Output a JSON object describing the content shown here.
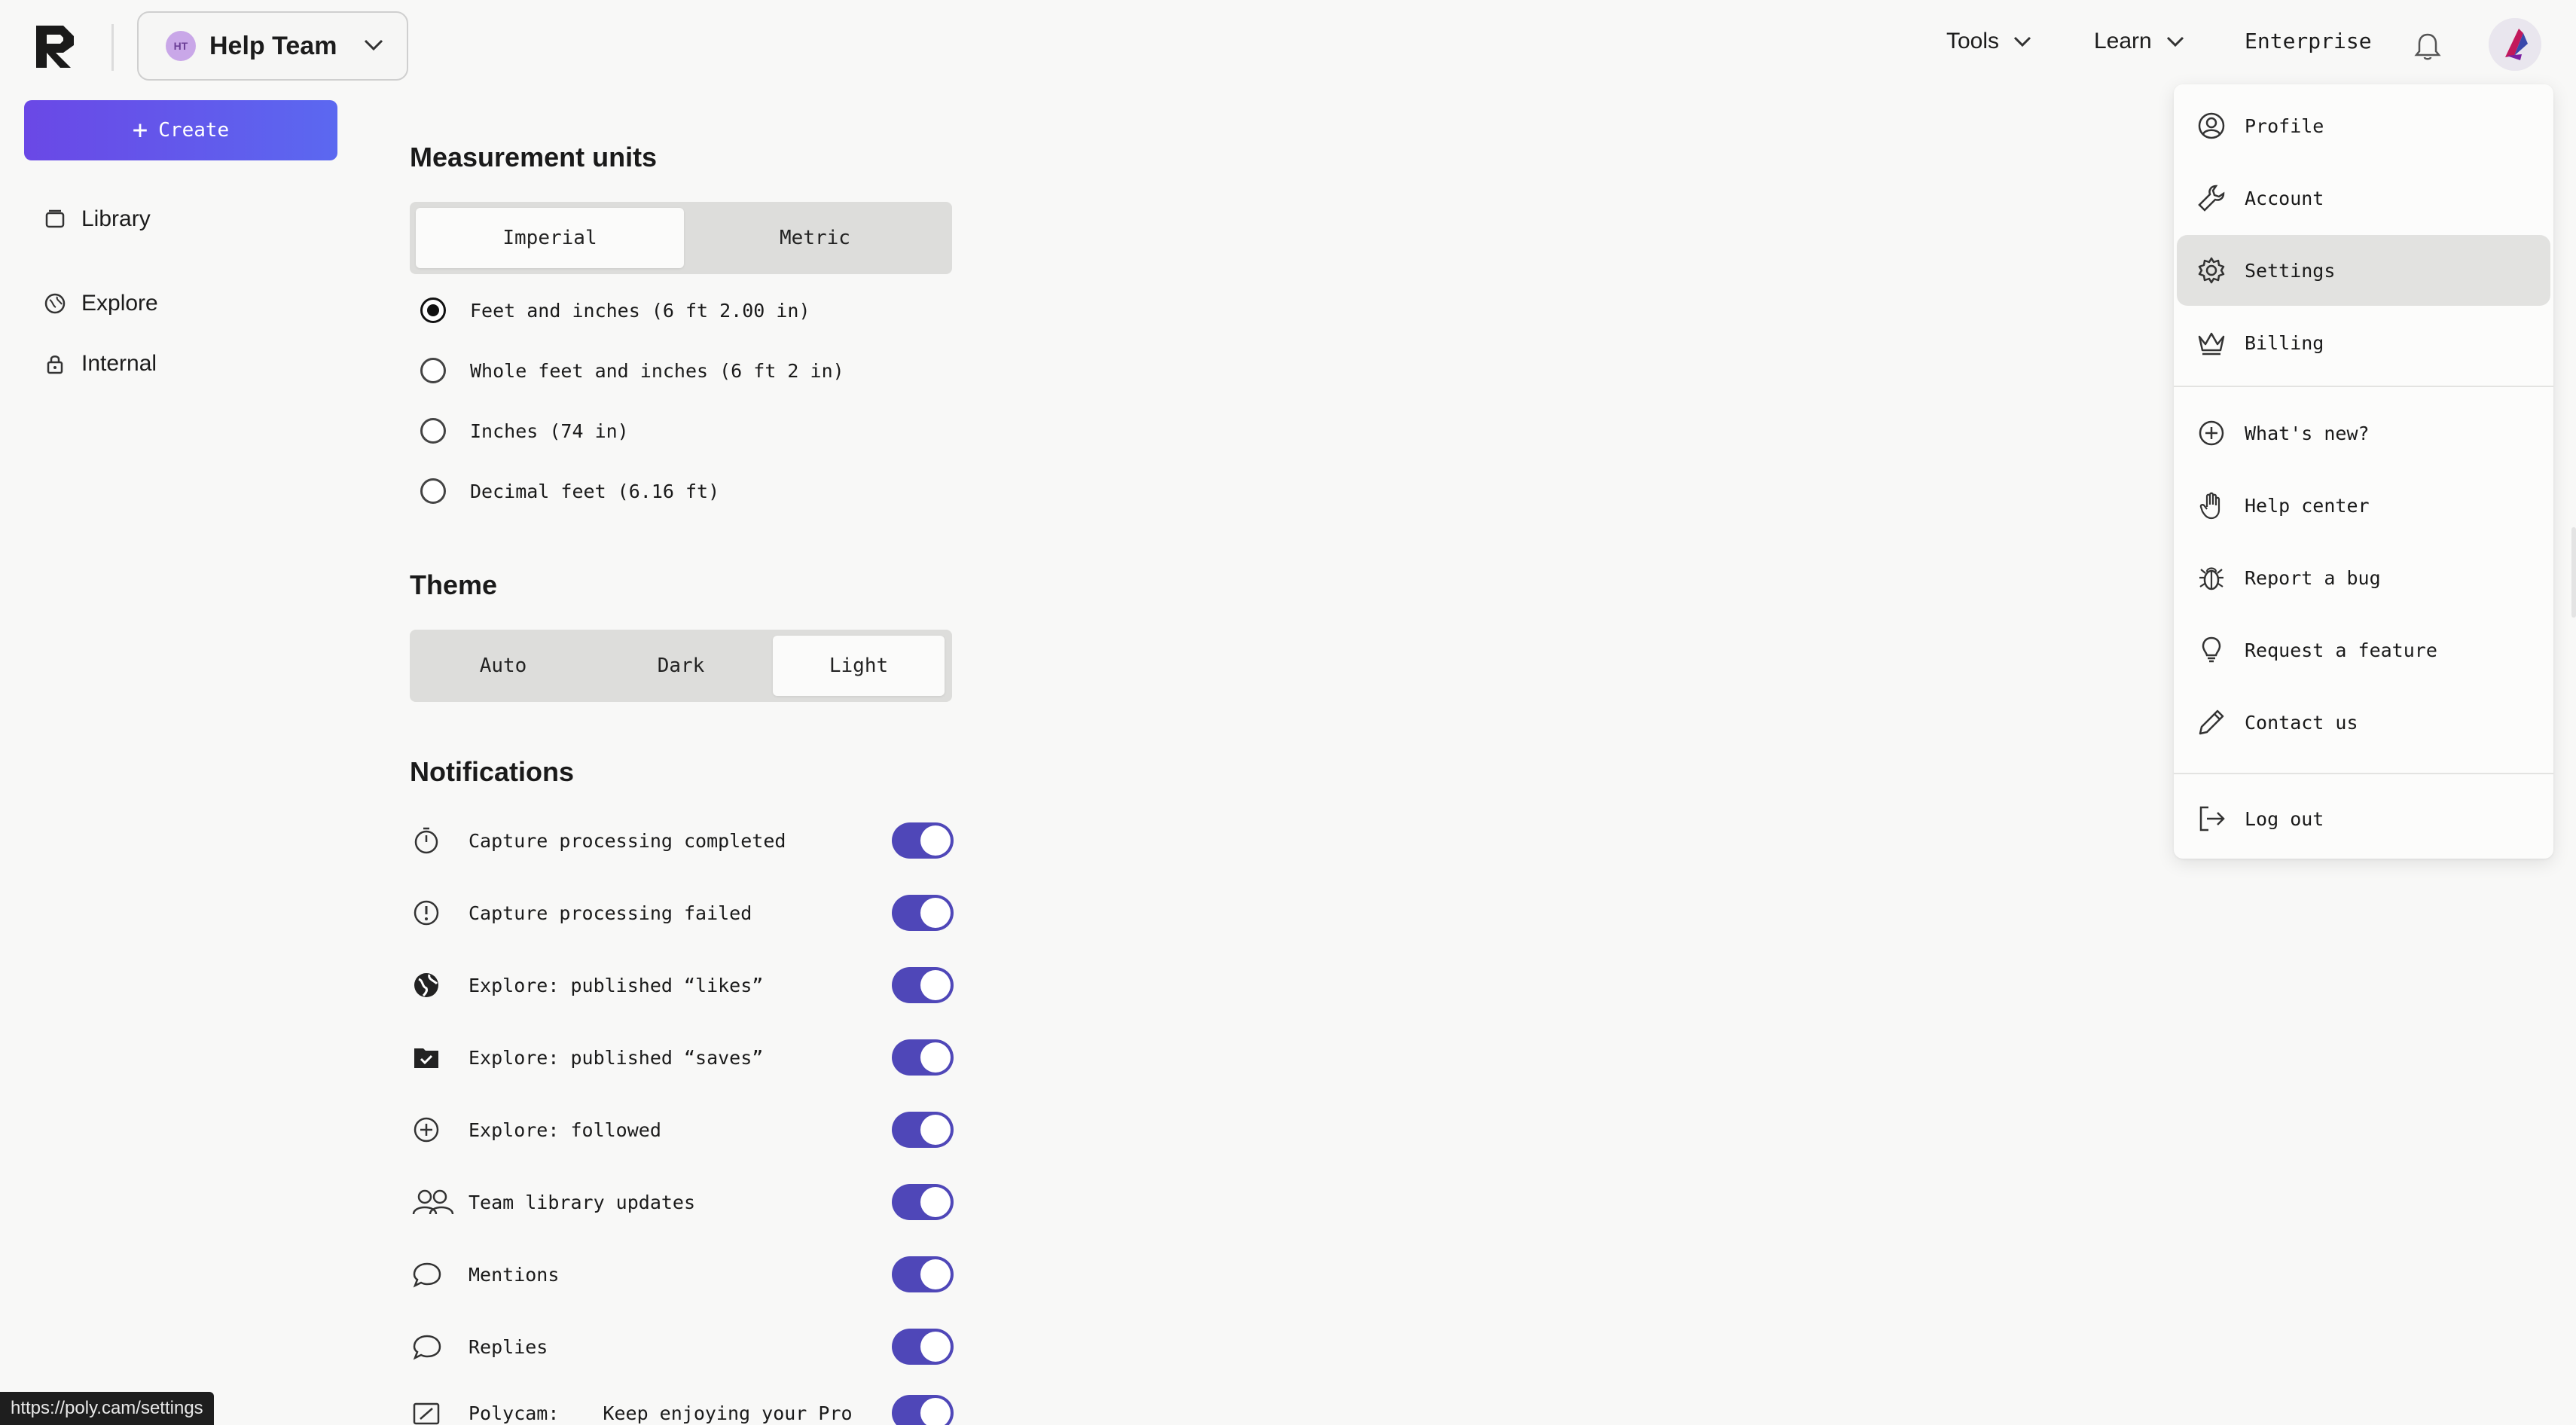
{
  "team": {
    "initials": "HT",
    "name": "Help Team"
  },
  "topnav": {
    "tools": "Tools",
    "learn": "Learn",
    "enterprise": "Enterprise"
  },
  "sidebar": {
    "create": "Create",
    "items": [
      {
        "label": "Library",
        "icon": "library-icon"
      },
      {
        "label": "Explore",
        "icon": "globe-icon"
      },
      {
        "label": "Internal",
        "icon": "lock-icon"
      }
    ]
  },
  "measurement": {
    "title": "Measurement units",
    "tabs": [
      "Imperial",
      "Metric"
    ],
    "active_tab": "Imperial",
    "options": [
      {
        "label": "Feet and inches (6 ft 2.00 in)",
        "checked": true
      },
      {
        "label": "Whole feet and inches (6 ft 2 in)",
        "checked": false
      },
      {
        "label": "Inches (74 in)",
        "checked": false
      },
      {
        "label": "Decimal feet (6.16 ft)",
        "checked": false
      }
    ]
  },
  "theme": {
    "title": "Theme",
    "options": [
      "Auto",
      "Dark",
      "Light"
    ],
    "active": "Light"
  },
  "notifications": {
    "title": "Notifications",
    "items": [
      {
        "label": "Capture processing completed",
        "icon": "timer-icon",
        "on": true
      },
      {
        "label": "Capture processing failed",
        "icon": "alert-circle-icon",
        "on": true
      },
      {
        "label": "Explore: published “likes”",
        "icon": "globe-filled-icon",
        "on": true
      },
      {
        "label": "Explore: published “saves”",
        "icon": "folder-check-icon",
        "on": true
      },
      {
        "label": "Explore: followed",
        "icon": "plus-circle-icon",
        "on": true
      },
      {
        "label": "Team library updates",
        "icon": "users-icon",
        "on": true
      },
      {
        "label": "Mentions",
        "icon": "chat-bubble-icon",
        "on": true
      },
      {
        "label": "Replies",
        "icon": "chat-bubble-icon",
        "on": true
      },
      {
        "label": "Polycam:",
        "extra": "Keep enjoying your Pro",
        "icon": "promo-icon",
        "on": true
      }
    ]
  },
  "menu": {
    "items": [
      {
        "label": "Profile",
        "icon": "user-circle-icon"
      },
      {
        "label": "Account",
        "icon": "wrench-icon"
      },
      {
        "label": "Settings",
        "icon": "gear-icon",
        "active": true
      },
      {
        "label": "Billing",
        "icon": "crown-icon"
      },
      {
        "label": "What's new?",
        "icon": "plus-circle-icon"
      },
      {
        "label": "Help center",
        "icon": "hand-icon"
      },
      {
        "label": "Report a bug",
        "icon": "bug-icon"
      },
      {
        "label": "Request a feature",
        "icon": "lightbulb-icon"
      },
      {
        "label": "Contact us",
        "icon": "pencil-icon"
      },
      {
        "label": "Log out",
        "icon": "logout-icon"
      }
    ]
  },
  "status_url": "https://poly.cam/settings",
  "colors": {
    "accent": "#4f47b8",
    "create_gradient_start": "#6a48e6",
    "create_gradient_end": "#5b68f0"
  }
}
